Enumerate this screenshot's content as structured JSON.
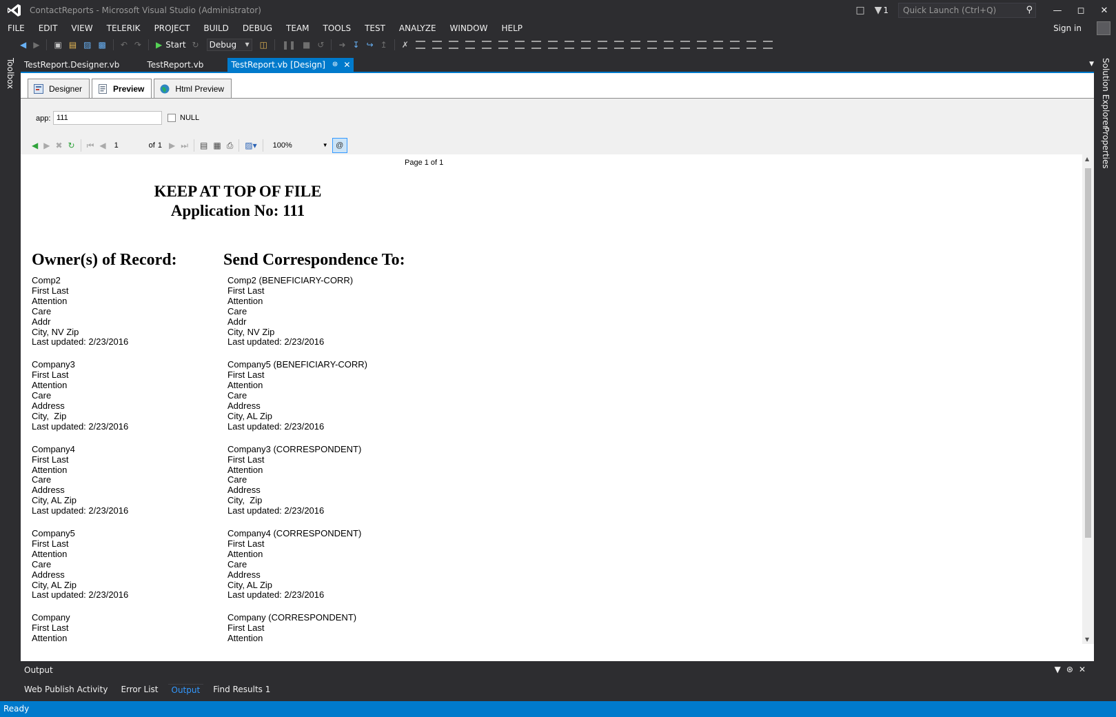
{
  "window": {
    "title": "ContactReports - Microsoft Visual Studio (Administrator)",
    "notification_count": "1",
    "quick_launch_placeholder": "Quick Launch (Ctrl+Q)",
    "sign_in": "Sign in"
  },
  "menu": [
    "FILE",
    "EDIT",
    "VIEW",
    "TELERIK",
    "PROJECT",
    "BUILD",
    "DEBUG",
    "TEAM",
    "TOOLS",
    "TEST",
    "ANALYZE",
    "WINDOW",
    "HELP"
  ],
  "toolbar": {
    "start_label": "Start",
    "configuration": "Debug"
  },
  "side_panels": {
    "left": "Toolbox",
    "right_top": "Solution Explorer",
    "right_bottom": "Properties"
  },
  "doc_tabs": [
    {
      "label": "TestReport.Designer.vb",
      "active": false
    },
    {
      "label": "TestReport.vb",
      "active": false
    },
    {
      "label": "TestReport.vb [Design]",
      "active": true
    }
  ],
  "report_viewer_tabs": [
    {
      "label": "Designer",
      "active": false
    },
    {
      "label": "Preview",
      "active": true
    },
    {
      "label": "Html Preview",
      "active": false
    }
  ],
  "parameters": {
    "label": "app:",
    "value": "111",
    "null_label": "NULL",
    "null_checked": false
  },
  "navigation": {
    "current_page": "1",
    "of_label": "of",
    "total_pages": "1",
    "zoom": "100%"
  },
  "report": {
    "page_indicator": "Page 1 of 1",
    "title_line1": "KEEP AT TOP OF FILE",
    "title_line2": "Application No: 111",
    "owners_heading": "Owner(s) of Record:",
    "correspondence_heading": "Send Correspondence To:",
    "owners": [
      [
        "Comp2",
        "First Last",
        "Attention",
        "Care",
        "Addr",
        "City, NV Zip",
        "Last updated: 2/23/2016"
      ],
      [
        "Company3",
        "First Last",
        "Attention",
        "Care",
        "Address",
        "City,  Zip",
        "Last updated: 2/23/2016"
      ],
      [
        "Company4",
        "First Last",
        "Attention",
        "Care",
        "Address",
        "City, AL Zip",
        "Last updated: 2/23/2016"
      ],
      [
        "Company5",
        "First Last",
        "Attention",
        "Care",
        "Address",
        "City, AL Zip",
        "Last updated: 2/23/2016"
      ],
      [
        "Company",
        "First Last",
        "Attention"
      ]
    ],
    "correspondence": [
      [
        "Comp2 (BENEFICIARY-CORR)",
        "First Last",
        "Attention",
        "Care",
        "Addr",
        "City, NV Zip",
        "Last updated: 2/23/2016"
      ],
      [
        "Company5 (BENEFICIARY-CORR)",
        "First Last",
        "Attention",
        "Care",
        "Address",
        "City, AL Zip",
        "Last updated: 2/23/2016"
      ],
      [
        "Company3 (CORRESPONDENT)",
        "First Last",
        "Attention",
        "Care",
        "Address",
        "City,  Zip",
        "Last updated: 2/23/2016"
      ],
      [
        "Company4 (CORRESPONDENT)",
        "First Last",
        "Attention",
        "Care",
        "Address",
        "City, AL Zip",
        "Last updated: 2/23/2016"
      ],
      [
        "Company (CORRESPONDENT)",
        "First Last",
        "Attention"
      ]
    ]
  },
  "output_panel": {
    "title": "Output",
    "tabs": [
      {
        "label": "Web Publish Activity",
        "active": false
      },
      {
        "label": "Error List",
        "active": false
      },
      {
        "label": "Output",
        "active": true
      },
      {
        "label": "Find Results 1",
        "active": false
      }
    ]
  },
  "status": "Ready",
  "colors": {
    "accent": "#007acc",
    "chrome": "#2d2d30"
  }
}
